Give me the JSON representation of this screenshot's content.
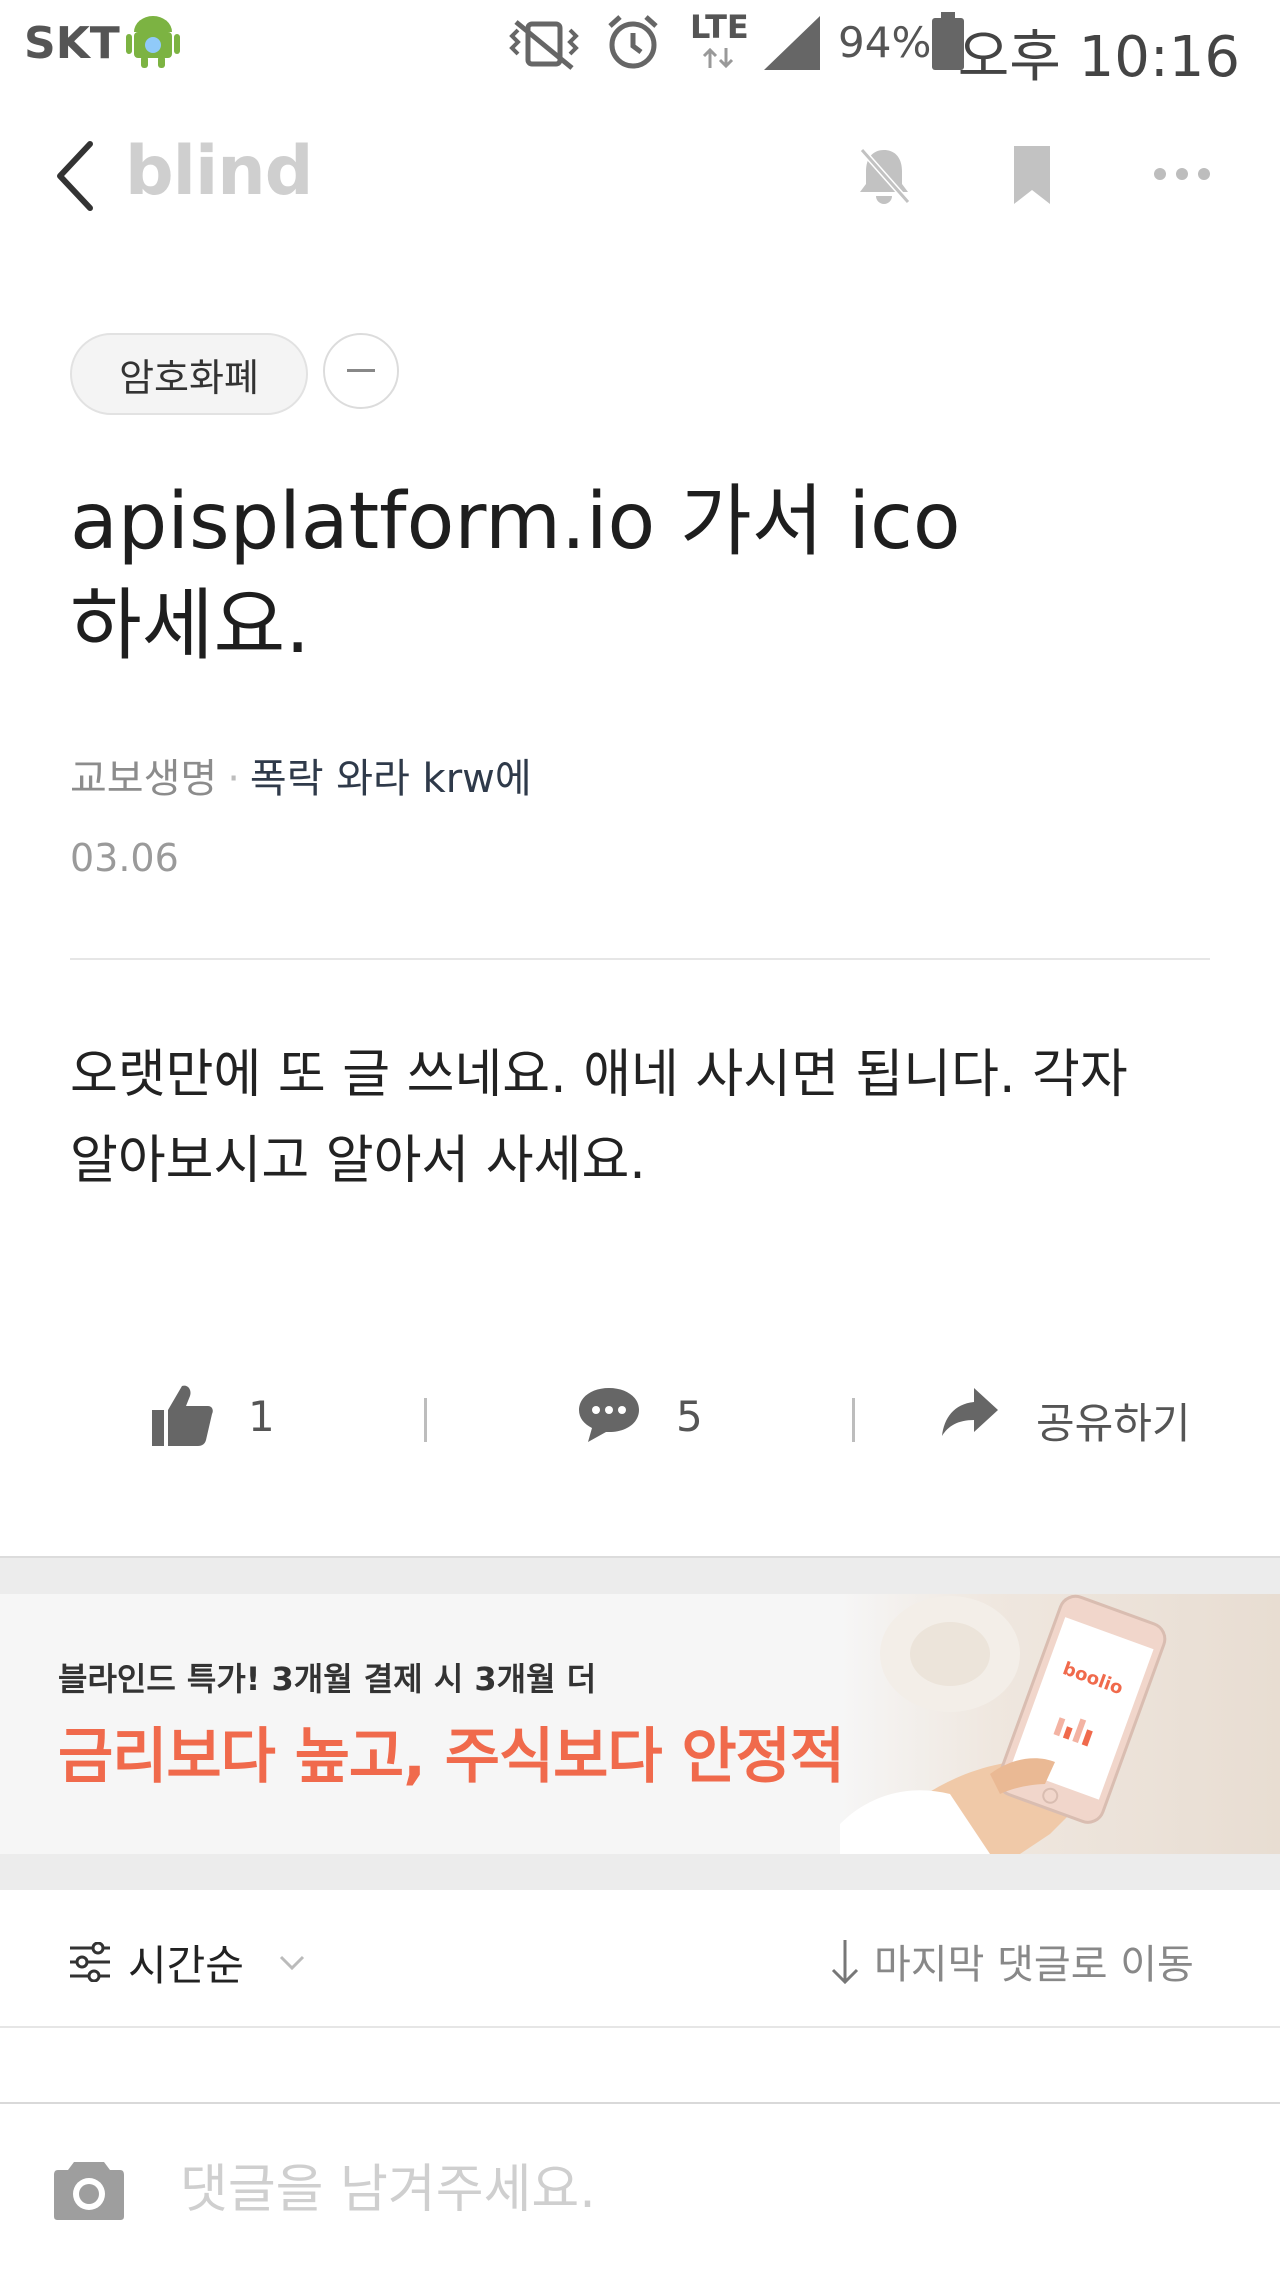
{
  "status_bar": {
    "carrier": "SKT",
    "network": "LTE",
    "battery": "94%",
    "time": "오후 10:16",
    "icons": [
      "android-icon",
      "vibrate-off-icon",
      "alarm-icon",
      "lte-icon",
      "signal-icon",
      "battery-icon"
    ]
  },
  "header": {
    "brand": "blind",
    "icons": [
      "back-icon",
      "bell-off-icon",
      "bookmark-icon",
      "more-icon"
    ]
  },
  "post": {
    "tag": "암호화폐",
    "title_line1": "apisplatform.io  가서 ico",
    "title_line2": "하세요.",
    "company": "교보생명",
    "author": "폭락 와라 krw에",
    "date": "03.06",
    "body_line1": "오랫만에 또 글 쓰네요. 애네 사시면 됩니다.  각자",
    "body_line2": "알아보시고 알아서 사세요."
  },
  "actions": {
    "likes": "1",
    "comments": "5",
    "share_label": "공유하기"
  },
  "banner": {
    "subtitle": "블라인드 특가! 3개월 결제 시 3개월 더",
    "headline": "금리보다 높고, 주식보다 안정적인 ?",
    "app_name": "boolio"
  },
  "sort_bar": {
    "sort_label": "시간순",
    "jump_label": "마지막 댓글로 이동"
  },
  "comment_bar": {
    "placeholder": "댓글을 남겨주세요."
  },
  "colors": {
    "accent": "#f06a4c",
    "brand_gray": "#cfcfcf",
    "icon_gray": "#bdbdbd"
  }
}
